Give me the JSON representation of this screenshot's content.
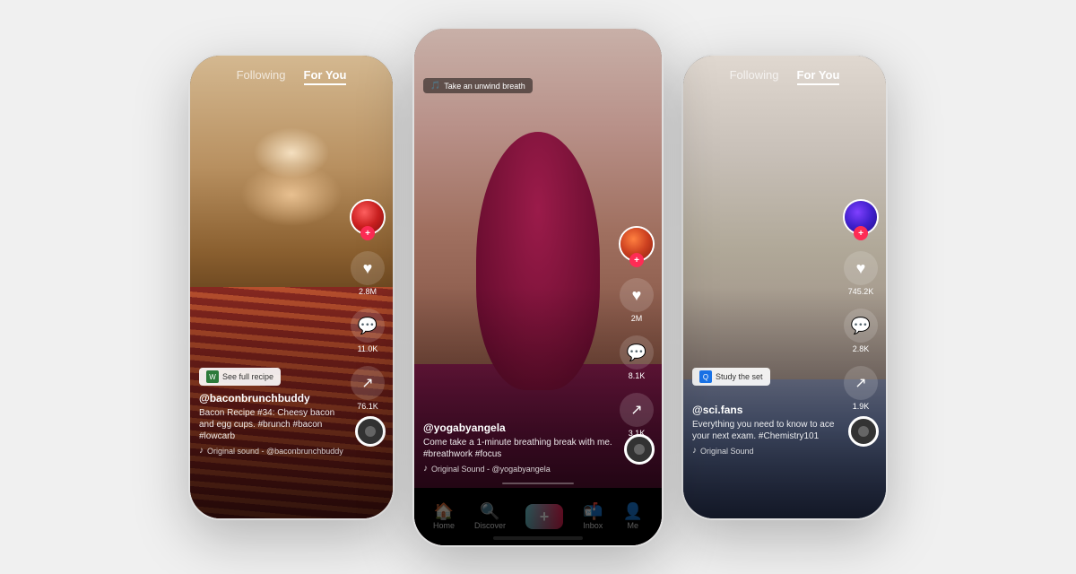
{
  "page": {
    "bg_color": "#f5f5f5"
  },
  "left_phone": {
    "tabs": {
      "following": "Following",
      "for_you": "For You"
    },
    "active_tab": "for_you",
    "recipe_badge": "See full recipe",
    "username": "@baconbrunchbuddy",
    "description": "Bacon Recipe #34: Cheesy bacon and egg cups. #brunch #bacon #lowcarb",
    "sound": "Original sound - @baconbrunchbuddy",
    "likes": "2.8M",
    "comments": "11.0K",
    "shares": "76.1K"
  },
  "center_phone": {
    "breath_badge": "Take an unwind breath",
    "username": "@yogabyangela",
    "description": "Come take a 1-minute breathing break with me. #breathwork #focus",
    "sound": "Original Sound - @yogabyangela",
    "likes": "2M",
    "comments": "8.1K",
    "shares": "3.1K",
    "nav": {
      "home": "Home",
      "discover": "Discover",
      "plus": "+",
      "inbox": "Inbox",
      "me": "Me"
    }
  },
  "right_phone": {
    "tabs": {
      "following": "Following",
      "for_you": "For You"
    },
    "active_tab": "for_you",
    "study_badge": "Study the set",
    "username": "@sci.fans",
    "description": "Everything you need to know to ace your next exam. #Chemistry101",
    "sound": "Original Sound",
    "likes": "745.2K",
    "comments": "2.8K",
    "shares": "1.9K"
  }
}
